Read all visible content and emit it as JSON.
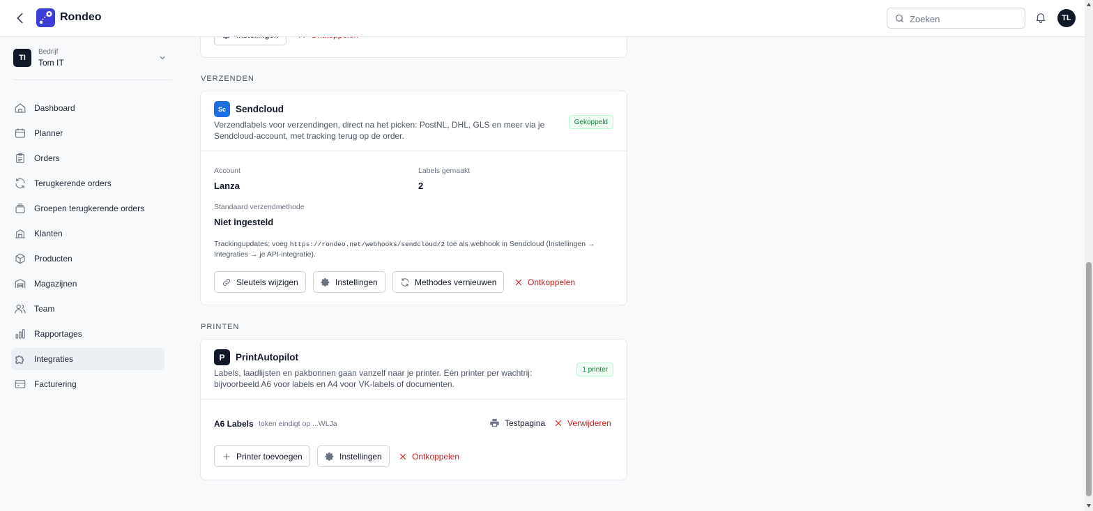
{
  "header": {
    "app_title": "Rondeo",
    "search_placeholder": "Zoeken",
    "avatar_initials": "TL"
  },
  "sidebar": {
    "company_caption": "Bedrijf",
    "company_name": "Tom IT",
    "company_initials": "TI",
    "items": [
      {
        "label": "Dashboard",
        "icon": "home-icon"
      },
      {
        "label": "Planner",
        "icon": "calendar-icon"
      },
      {
        "label": "Orders",
        "icon": "clipboard-icon"
      },
      {
        "label": "Terugkerende orders",
        "icon": "refresh-icon"
      },
      {
        "label": "Groepen terugkerende orders",
        "icon": "layers-icon"
      },
      {
        "label": "Klanten",
        "icon": "building-icon"
      },
      {
        "label": "Producten",
        "icon": "box-icon"
      },
      {
        "label": "Magazijnen",
        "icon": "warehouse-icon"
      },
      {
        "label": "Team",
        "icon": "users-icon"
      },
      {
        "label": "Rapportages",
        "icon": "chart-bar-icon"
      },
      {
        "label": "Integraties",
        "icon": "puzzle-icon",
        "active": true
      },
      {
        "label": "Facturering",
        "icon": "credit-card-icon"
      }
    ]
  },
  "top_card": {
    "settings_label": "Instellingen",
    "disconnect_label": "Ontkoppelen"
  },
  "shipping": {
    "section_label": "VERZENDEN",
    "logo_text": "Sc",
    "title": "Sendcloud",
    "description": "Verzendlabels voor verzendingen, direct na het picken: PostNL, DHL, GLS en meer via je Sendcloud-account, met tracking terug op de order.",
    "status_badge": "Gekoppeld",
    "account_label": "Account",
    "account_value": "Lanza",
    "labels_made_label": "Labels gemaakt",
    "labels_made_value": "2",
    "default_method_label": "Standaard verzendmethode",
    "default_method_value": "Niet ingesteld",
    "note_prefix": "Trackingupdates: voeg",
    "note_url": "https://rondeo.net/webhooks/sendcloud/2",
    "note_suffix": "toe als webhook in Sendcloud (Instellingen → Integraties → je API-integratie).",
    "buttons": {
      "change_keys": "Sleutels wijzigen",
      "settings": "Instellingen",
      "refresh_methods": "Methodes vernieuwen",
      "disconnect": "Ontkoppelen"
    }
  },
  "printing": {
    "section_label": "PRINTEN",
    "logo_text": "P",
    "title": "PrintAutopilot",
    "description": "Labels, laadlijsten en pakbonnen gaan vanzelf naar je printer. Eén printer per wachtrij: bijvoorbeeld A6 voor labels en A4 voor VK-labels of documenten.",
    "status_badge": "1 printer",
    "printer": {
      "name": "A6 Labels",
      "token_note": "token eindigt op ...WLJa",
      "test_page": "Testpagina",
      "remove": "Verwijderen"
    },
    "buttons": {
      "add_printer": "Printer toevoegen",
      "settings": "Instellingen",
      "disconnect": "Ontkoppelen"
    }
  },
  "colors": {
    "brand": "#3b3fd8",
    "danger": "#c81e1e",
    "success": "#15803d",
    "sendcloud": "#1b6fe0"
  }
}
